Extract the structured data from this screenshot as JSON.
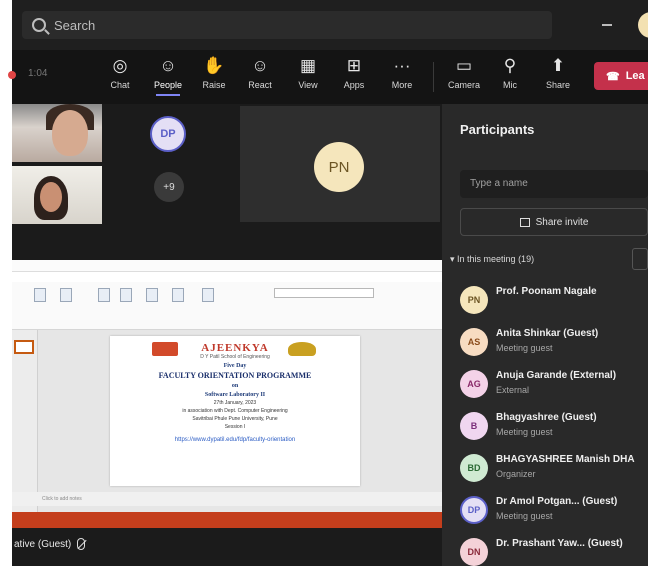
{
  "header": {
    "search_placeholder": "Search",
    "overflow": "···"
  },
  "toolbar": {
    "record_time": "1:04",
    "buttons": [
      {
        "label": "Chat",
        "icon": "chat-icon",
        "glyph": "◎"
      },
      {
        "label": "People",
        "icon": "people-icon",
        "glyph": "☺"
      },
      {
        "label": "Raise",
        "icon": "raise-hand-icon",
        "glyph": "✋"
      },
      {
        "label": "React",
        "icon": "react-icon",
        "glyph": "☺"
      },
      {
        "label": "View",
        "icon": "view-icon",
        "glyph": "▦"
      },
      {
        "label": "Apps",
        "icon": "apps-icon",
        "glyph": "⊞"
      },
      {
        "label": "More",
        "icon": "more-icon",
        "glyph": "···"
      },
      {
        "label": "Camera",
        "icon": "camera-icon",
        "glyph": "▭"
      },
      {
        "label": "Mic",
        "icon": "mic-icon",
        "glyph": "⚲"
      },
      {
        "label": "Share",
        "icon": "share-icon",
        "glyph": "⬆"
      }
    ],
    "active": "People",
    "leave_label": "Lea"
  },
  "stage": {
    "avatar_dp": "DP",
    "more_count": "+9",
    "avatar_pn": "PN",
    "presenter_label": "ative (Guest)"
  },
  "slide": {
    "title": "AJEENKYA",
    "subtitle": "D Y Patil School of Engineering",
    "line1": "Five Day",
    "program": "FACULTY ORIENTATION PROGRAMME",
    "on": "on",
    "topic": "Software Laboratory II",
    "dates": "27th January, 2023",
    "assoc": "in association with Dept. Computer Engineering",
    "univ": "Savitribai Phule Pune University, Pune",
    "day": "Session I",
    "link": "https://www.dypatil.edu/fdp/faculty-orientation",
    "notes": "Click to add notes"
  },
  "participants": {
    "title": "Participants",
    "search_placeholder": "Type a name",
    "share_invite": "Share invite",
    "section": "In this meeting (19)",
    "list": [
      {
        "initials": "PN",
        "name": "Prof. Poonam Nagale",
        "role": "",
        "bg": "#f5e6bc",
        "fg": "#6b5423"
      },
      {
        "initials": "AS",
        "name": "Anita Shinkar (Guest)",
        "role": "Meeting guest",
        "bg": "#f7dcc2",
        "fg": "#8a4b1b"
      },
      {
        "initials": "AG",
        "name": "Anuja Garande (External)",
        "role": "External",
        "bg": "#f4d2e8",
        "fg": "#8a2a6a"
      },
      {
        "initials": "B",
        "name": "Bhagyashree (Guest)",
        "role": "Meeting guest",
        "bg": "#f0d6f0",
        "fg": "#7a2d7a"
      },
      {
        "initials": "BD",
        "name": "BHAGYASHREE Manish DHA",
        "role": "Organizer",
        "bg": "#cfead2",
        "fg": "#2b6a35"
      },
      {
        "initials": "DP",
        "name": "Dr Amol Potgan... (Guest)",
        "role": "Meeting guest",
        "bg": "#e4dff5",
        "fg": "#5b5fc7"
      },
      {
        "initials": "DN",
        "name": "Dr. Prashant Yaw... (Guest)",
        "role": "",
        "bg": "#f4d2d8",
        "fg": "#8a2a3a"
      }
    ]
  }
}
